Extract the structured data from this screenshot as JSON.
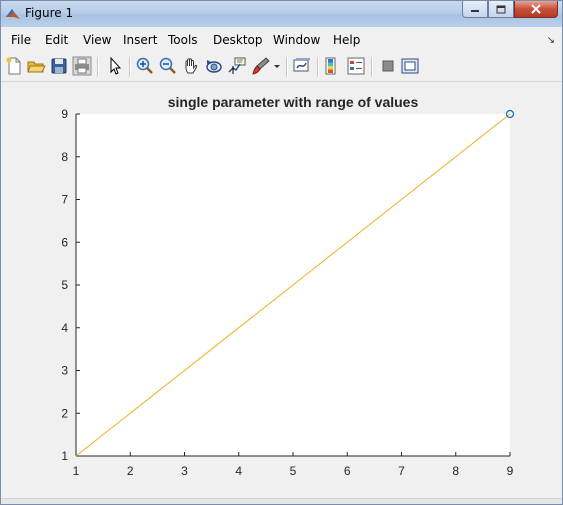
{
  "window": {
    "title": "Figure 1",
    "controls": [
      "minimize",
      "restore",
      "close"
    ]
  },
  "menubar": {
    "items": [
      "File",
      "Edit",
      "View",
      "Insert",
      "Tools",
      "Desktop",
      "Window",
      "Help"
    ]
  },
  "toolbar": {
    "icons": [
      "new-figure-icon",
      "open-file-icon",
      "save-icon",
      "print-icon",
      "select-arrow-icon",
      "zoom-in-icon",
      "zoom-out-icon",
      "pan-hand-icon",
      "rotate-3d-icon",
      "data-cursor-icon",
      "brush-icon",
      "dropdown-arrow-icon",
      "link-plot-icon",
      "colorbar-icon",
      "legend-icon",
      "hide-plot-tools-icon",
      "show-plot-tools-icon"
    ]
  },
  "colors": {
    "line": "#edb120",
    "marker": "#0072bd",
    "axes_bg": "#ffffff",
    "figure_bg": "#f0f0f0"
  },
  "chart_data": {
    "type": "line",
    "title": "single parameter with range of values",
    "xlabel": "",
    "ylabel": "",
    "xlim": [
      1,
      9
    ],
    "ylim": [
      1,
      9
    ],
    "xticks": [
      "1",
      "2",
      "3",
      "4",
      "5",
      "6",
      "7",
      "8",
      "9"
    ],
    "yticks": [
      "1",
      "2",
      "3",
      "4",
      "5",
      "6",
      "7",
      "8",
      "9"
    ],
    "grid": false,
    "legend": false,
    "series": [
      {
        "x": [
          1,
          9
        ],
        "y": [
          1,
          9
        ],
        "color": "#edb120",
        "style": "line"
      },
      {
        "x": [
          9
        ],
        "y": [
          9
        ],
        "color": "#0072bd",
        "style": "marker-circle"
      }
    ]
  }
}
